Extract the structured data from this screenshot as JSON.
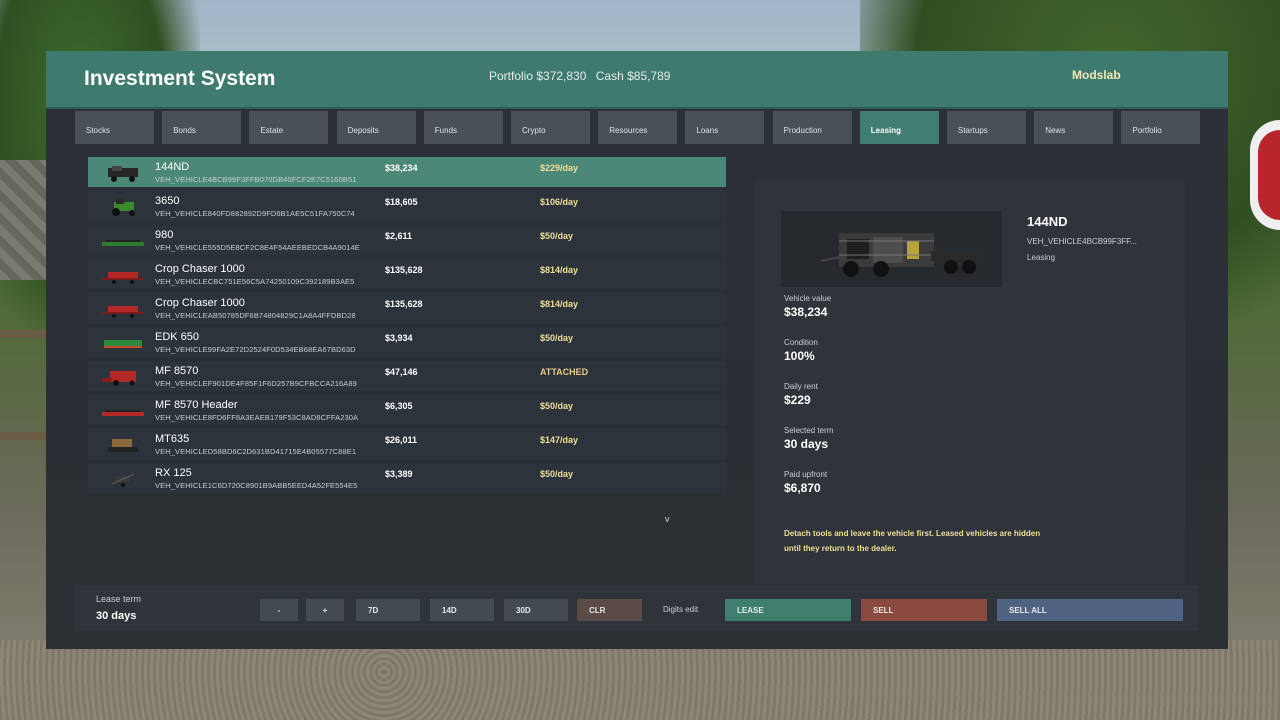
{
  "header": {
    "title": "Investment System",
    "portfolio": "Portfolio $372,830",
    "cash": "Cash $85,789",
    "brand": "Modslab"
  },
  "tabs": [
    {
      "label": "Stocks"
    },
    {
      "label": "Bonds"
    },
    {
      "label": "Estate"
    },
    {
      "label": "Deposits"
    },
    {
      "label": "Funds"
    },
    {
      "label": "Crypto"
    },
    {
      "label": "Resources"
    },
    {
      "label": "Loans"
    },
    {
      "label": "Production"
    },
    {
      "label": "Leasing"
    },
    {
      "label": "Startups"
    },
    {
      "label": "News"
    },
    {
      "label": "Portfolio"
    }
  ],
  "active_tab": "Leasing",
  "vehicles": [
    {
      "name": "144ND",
      "id": "VEH_VEHICLE4BCB99F3FFB070DB40FCF2E7C5160B51",
      "price": "$38,234",
      "rent": "$229/day",
      "icon": "tractor-dark-icon",
      "color": "#262626"
    },
    {
      "name": "3650",
      "id": "VEH_VEHICLE840FD882892D9FD6B1AE5C51FA750C74",
      "price": "$18,605",
      "rent": "$106/day",
      "icon": "tractor-icon",
      "color": "#3d8a2a"
    },
    {
      "name": "980",
      "id": "VEH_VEHICLE555D5E8CF2C8E4F54AEEBEDCB4A9014E",
      "price": "$2,611",
      "rent": "$50/day",
      "icon": "header-attachment-icon",
      "color": "#2e7a2e"
    },
    {
      "name": "Crop Chaser 1000",
      "id": "VEH_VEHICLECBC751E56C5A74250109C392189B3AE5",
      "price": "$135,628",
      "rent": "$814/day",
      "icon": "sprayer-icon",
      "color": "#b42828"
    },
    {
      "name": "Crop Chaser 1000",
      "id": "VEH_VEHICLEAB50785DF6B74804829C1A8A4FFDBD28",
      "price": "$135,628",
      "rent": "$814/day",
      "icon": "sprayer-icon",
      "color": "#b42828"
    },
    {
      "name": "EDK 650",
      "id": "VEH_VEHICLE99FA2E72D2524F0D534EB68EA67BD63D",
      "price": "$3,934",
      "rent": "$50/day",
      "icon": "drill-icon",
      "color": "#2e8a3e"
    },
    {
      "name": "MF 8570",
      "id": "VEH_VEHICLEF901DE4F85F1F6D257B9CFBCCA216A89",
      "price": "$47,146",
      "rent": "ATTACHED",
      "icon": "combine-icon",
      "color": "#b42828"
    },
    {
      "name": "MF 8570 Header",
      "id": "VEH_VEHICLE8FD6FF8A3EAEB179F53C8AD8CFFA230A",
      "price": "$6,305",
      "rent": "$50/day",
      "icon": "header-attachment-icon",
      "color": "#b42828"
    },
    {
      "name": "MT635",
      "id": "VEH_VEHICLED58BD6C2D631BD41715E4B05577C88E1",
      "price": "$26,011",
      "rent": "$147/day",
      "icon": "tracked-tractor-icon",
      "color": "#8a6a3a"
    },
    {
      "name": "RX 125",
      "id": "VEH_VEHICLE1C6D720C8901B9ABB5EED4A52FE554E5",
      "price": "$3,389",
      "rent": "$50/day",
      "icon": "small-implement-icon",
      "color": "#3a3a3a"
    }
  ],
  "scroll_indicator": "v",
  "detail": {
    "name": "144ND",
    "id_short": "VEH_VEHICLE4BCB99F3FF...",
    "status": "Leasing",
    "stats": [
      {
        "label": "Vehicle value",
        "value": "$38,234"
      },
      {
        "label": "Condition",
        "value": "100%"
      },
      {
        "label": "Daily rent",
        "value": "$229"
      },
      {
        "label": "Selected term",
        "value": "30 days"
      },
      {
        "label": "Paid upfront",
        "value": "$6,870"
      }
    ],
    "note": "Detach tools and leave the vehicle first. Leased vehicles are hidden until they return to the dealer."
  },
  "footer": {
    "lease_term_label": "Lease term",
    "lease_term_value": "30 days",
    "minus": "-",
    "plus": "+",
    "term_7d": "7D",
    "term_14d": "14D",
    "term_30d": "30D",
    "clear": "CLR",
    "digits_edit": "Digits edit",
    "lease": "LEASE",
    "sell": "SELL",
    "sell_all": "SELL ALL"
  },
  "colors": {
    "accent": "#3f7a6e",
    "selected_row": "#4b8878",
    "rent_text": "#f0df96",
    "lease_button": "#3f7e6c",
    "sell_button": "#8a4a40",
    "sell_all_button": "#4f6383"
  }
}
